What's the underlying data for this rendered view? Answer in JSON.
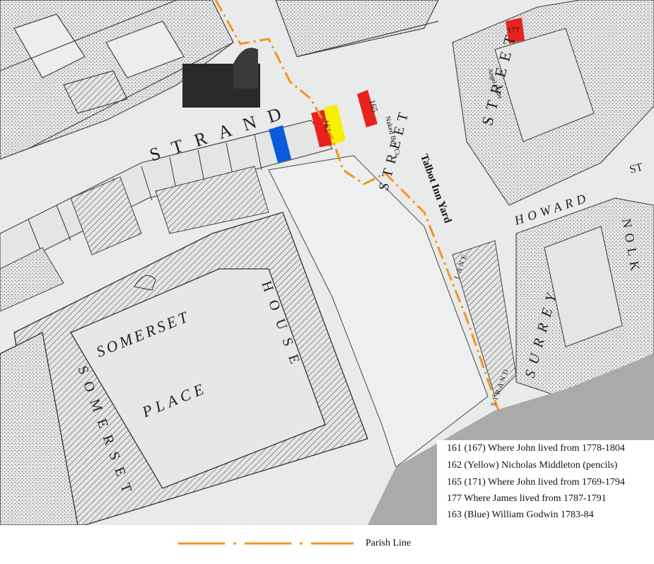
{
  "map": {
    "street_labels": {
      "strand": "STRAND",
      "somerset_place": [
        "SOMERSET",
        "PLACE"
      ],
      "somerset_house": [
        "SOMERSET",
        "HOUSE"
      ],
      "talbot_inn_yard": "Talbot Inn Yard",
      "naked_boy_ct": "Naked Boy Ct.",
      "angel_court": "Angel Court",
      "street_right": "STREET",
      "street_mid": "STREET",
      "howard": "HOWARD",
      "surrey": "SURREY",
      "lane": "LANE",
      "strand_lane": "STRAND",
      "norfolk_partial": "NOLK",
      "st_partial": "ST"
    },
    "house_numbers": {
      "n161": "161",
      "n165": "165",
      "n177": "177"
    },
    "highlight_colors": {
      "red": "#e8231f",
      "yellow": "#f6f000",
      "blue": "#0a5bdc",
      "parish": "#f0961e"
    }
  },
  "legend": {
    "items": [
      "161 (167) Where John lived from 1778-1804",
      "162 (Yellow) Nicholas Middleton (pencils)",
      "165 (171) Where John lived from 1769-1794",
      "177   Where James lived from 1787-1791",
      "163 (Blue) William Godwin 1783-84"
    ],
    "parish_label": "Parish Line"
  }
}
